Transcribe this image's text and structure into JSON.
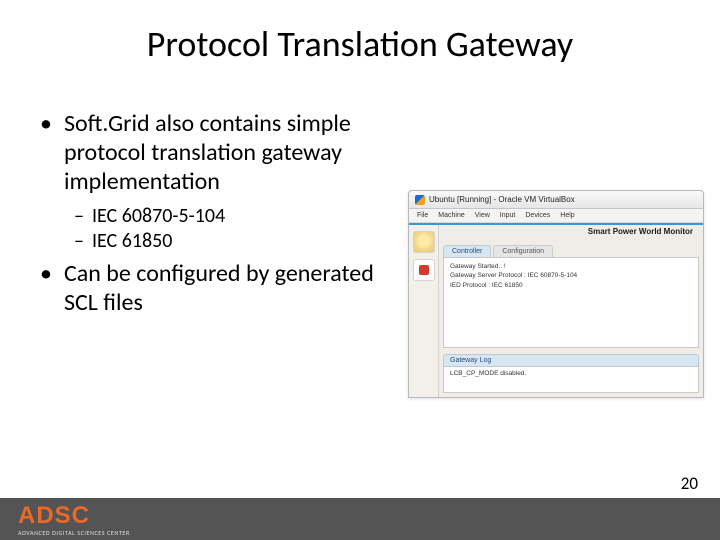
{
  "title": "Protocol Translation Gateway",
  "bullets": {
    "b1": "Soft.Grid also contains simple protocol translation gateway implementation",
    "b1_sub1": "IEC 60870-5-104",
    "b1_sub2": "IEC 61850",
    "b2": "Can be configured by generated SCL files"
  },
  "screenshot": {
    "window_title": "Ubuntu [Running] - Oracle VM VirtualBox",
    "menu": {
      "file": "File",
      "machine": "Machine",
      "view": "View",
      "input": "Input",
      "devices": "Devices",
      "help": "Help"
    },
    "app_title": "Smart Power World Monitor",
    "tabs": {
      "controller": "Controller",
      "configuration": "Configuration"
    },
    "panel": {
      "line1": "Gateway Started.. !",
      "line2": "Gateway Server Protocol  :  IEC 60870-5-104",
      "line3": "IED Protocol : IEC 61850"
    },
    "log": {
      "header": "Gateway Log",
      "body": "LCB_CP_MODE disabled."
    }
  },
  "footer": {
    "logo": "ADSC",
    "sub": "ADVANCED DIGITAL SCIENCES CENTER"
  },
  "page_number": "20"
}
